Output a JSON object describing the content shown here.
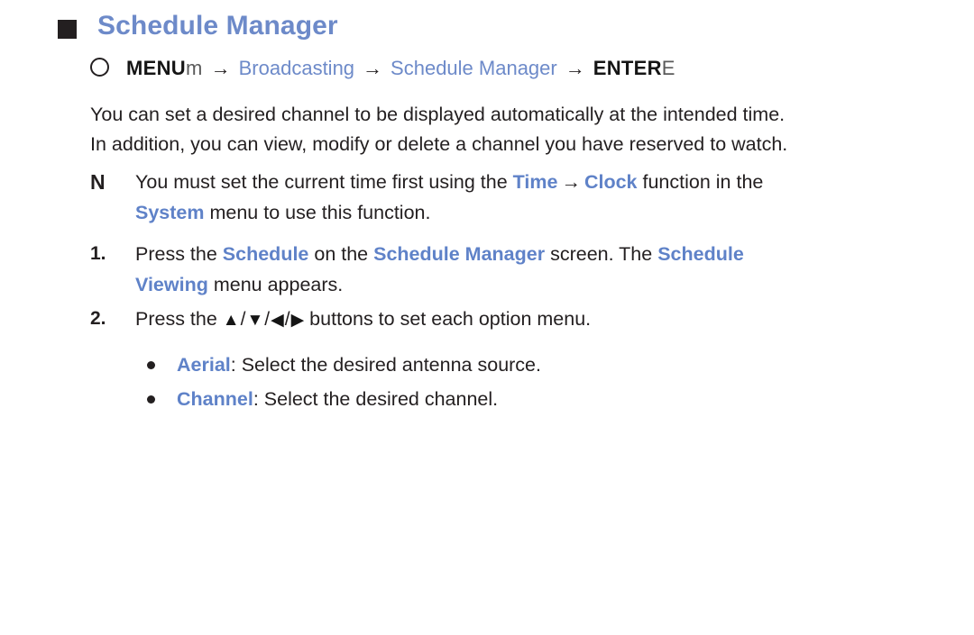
{
  "page": {
    "background_color": "#ffffff",
    "accent_blue": "#6d8ac9",
    "text_color": "#231f20"
  },
  "heading": {
    "marker": "square-bullet",
    "title": "Schedule Manager"
  },
  "menu_path": {
    "lead_icon": "circle-outline",
    "key_label": "MENU",
    "key_glyph": "m",
    "arrow": "→",
    "item_1": "Broadcasting",
    "item_2": "Schedule Manager",
    "enter_label": "ENTER",
    "enter_glyph": "E"
  },
  "paragraph": {
    "line_1": "You can set a desired channel to be displayed automatically at the intended time.",
    "line_2": "In addition, you can view, modify or delete a channel you have reserved to watch."
  },
  "note": {
    "marker": "N",
    "line_1_part_1": "You must set the current time first using the ",
    "line_1_menu_1": "Time",
    "line_1_arrow": "→",
    "line_1_menu_2": "Clock",
    "line_1_part_2": " function in the",
    "line_2_menu": "System",
    "line_2_text": " menu to use this function."
  },
  "steps": [
    {
      "marker": "1.",
      "line_1_part_1": "Press the ",
      "line_1_menu_1": "Schedule",
      "line_1_part_2": " on the ",
      "line_1_menu_2": "Schedule Manager",
      "line_1_part_3": " screen. The ",
      "line_1_menu_3": "Schedule",
      "line_2_menu": "Viewing",
      "line_2_text": " menu appears."
    },
    {
      "marker": "2.",
      "text_before": "Press the ",
      "key_up": "▲",
      "key_down": "▼",
      "key_left": "◀",
      "key_right": "▶",
      "separator": "/",
      "text_after": " buttons to set each option menu."
    }
  ],
  "bullets": [
    {
      "marker": "●",
      "menu": "Aerial",
      "text": ": Select the desired antenna source."
    },
    {
      "marker": "●",
      "menu": "Channel",
      "text": ": Select the desired channel."
    }
  ]
}
